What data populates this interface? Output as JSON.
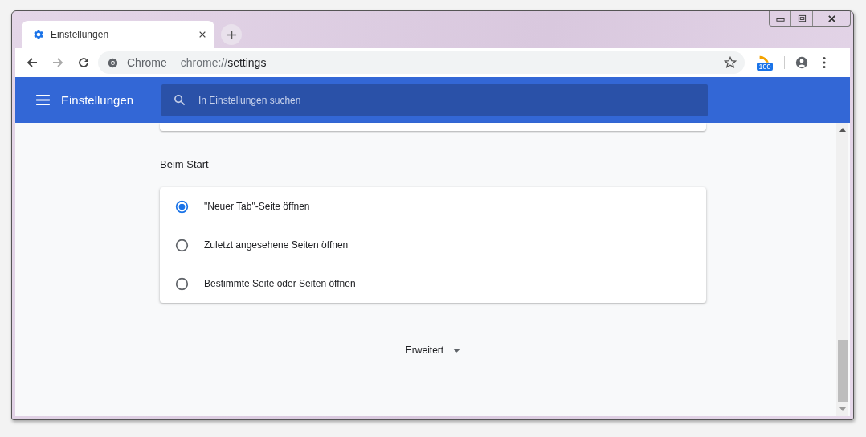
{
  "tab": {
    "title": "Einstellungen",
    "selected": true
  },
  "address_bar": {
    "site_label": "Chrome",
    "url_scheme": "chrome://",
    "url_path": "settings"
  },
  "extension_badge": "100",
  "header": {
    "title": "Einstellungen",
    "search": {
      "placeholder": "In Einstellungen suchen"
    }
  },
  "section": {
    "title": "Beim Start",
    "options": [
      {
        "label": "\"Neuer Tab\"-Seite öffnen",
        "selected": true
      },
      {
        "label": "Zuletzt angesehene Seiten öffnen",
        "selected": false
      },
      {
        "label": "Bestimmte Seite oder Seiten öffnen",
        "selected": false
      }
    ]
  },
  "advanced_button": {
    "label": "Erweitert",
    "expanded": false
  }
}
